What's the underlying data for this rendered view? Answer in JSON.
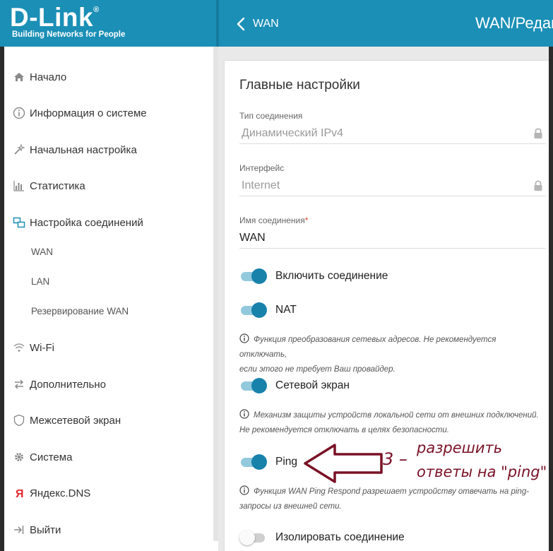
{
  "brand": {
    "logo_text": "D-Link",
    "logo_reg": "®",
    "tagline": "Building Networks for People",
    "color": "#1b8fb6"
  },
  "header": {
    "back_label": "WAN",
    "title": "WAN/Редак"
  },
  "sidebar": {
    "items": [
      {
        "label": "Начало",
        "icon": "home-icon"
      },
      {
        "label": "Информация о системе",
        "icon": "info-icon"
      },
      {
        "label": "Начальная настройка",
        "icon": "wand-icon"
      },
      {
        "label": "Статистика",
        "icon": "bar-chart-icon"
      },
      {
        "label": "Настройка соединений",
        "icon": "connections-icon"
      },
      {
        "label": "Wi-Fi",
        "icon": "wifi-icon"
      },
      {
        "label": "Дополнительно",
        "icon": "arrows-icon"
      },
      {
        "label": "Межсетевой экран",
        "icon": "shield-icon"
      },
      {
        "label": "Система",
        "icon": "gear-icon"
      },
      {
        "label": "Яндекс.DNS",
        "icon": "yandex-icon"
      },
      {
        "label": "Выйти",
        "icon": "logout-icon"
      }
    ],
    "subitems": [
      "WAN",
      "LAN",
      "Резервирование WAN"
    ]
  },
  "main": {
    "section_title": "Главные настройки",
    "connection_type": {
      "label": "Тип соединения",
      "value": "Динамический IPv4"
    },
    "interface": {
      "label": "Интерфейс",
      "value": "Internet"
    },
    "connection_name": {
      "label": "Имя соединения",
      "required_mark": "*",
      "value": "WAN"
    },
    "toggles": {
      "enable": {
        "label": "Включить соединение",
        "on": true
      },
      "nat": {
        "label": "NAT",
        "on": true,
        "hint_line1": "Функция преобразования сетевых адресов. Не рекомендуется отключать,",
        "hint_line2": "если этого не требует Ваш провайдер."
      },
      "firewall": {
        "label": "Сетевой экран",
        "on": true,
        "hint_line1": "Механизм защиты устройств локальной сети от внешних подключений.",
        "hint_line2": "Не рекомендуется отключать в целях безопасности."
      },
      "ping": {
        "label": "Ping",
        "on": true,
        "hint_line1": "Функция WAN Ping Respond разрешает устройству отвечать на ping-",
        "hint_line2": "запросы из внешней сети."
      },
      "isolate": {
        "label": "Изолировать соединение",
        "on": false
      }
    }
  },
  "annotation": {
    "number": "3 –",
    "line1": "разрешить",
    "line2": "ответы на \"ping\"",
    "color": "#7a1226"
  }
}
